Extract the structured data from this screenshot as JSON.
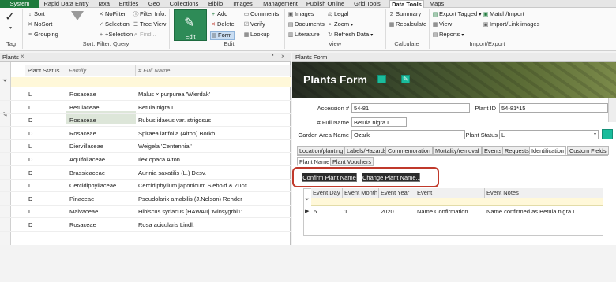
{
  "ribbon_tabs": [
    "System",
    "Rapid Data Entry",
    "Taxa",
    "Entities",
    "Geo",
    "Collections",
    "Biblio",
    "Images",
    "Management",
    "Publish Online",
    "Grid Tools",
    "Data Tools",
    "Maps"
  ],
  "ribbon": {
    "tag_group": {
      "label": "Tag"
    },
    "sort_group": {
      "label": "Sort, Filter, Query",
      "sort": "Sort",
      "nosort": "NoSort",
      "grouping": "Grouping",
      "nofilter": "NoFilter",
      "selection": "Selection",
      "add_selection": "+Selection",
      "filter_info": "Filter Info.",
      "tree_view": "Tree View",
      "find": "Find..."
    },
    "edit_group": {
      "label": "Edit",
      "edit": "Edit",
      "add": "Add",
      "delete": "Delete",
      "form": "Form",
      "comments": "Comments",
      "verify": "Verify",
      "lookup": "Lookup"
    },
    "view_group": {
      "label": "View",
      "images": "Images",
      "documents": "Documents",
      "literature": "Literature",
      "legal": "Legal",
      "zoom": "Zoom",
      "refresh": "Refresh Data"
    },
    "calc_group": {
      "label": "Calculate",
      "summary": "Summary",
      "recalculate": "Recalculate"
    },
    "io_group": {
      "label": "Import/Export",
      "export_tagged": "Export Tagged",
      "view": "View",
      "reports": "Reports",
      "match_import": "Match/Import",
      "import_link": "Import/Link images"
    }
  },
  "plants_grid": {
    "title": "Plants",
    "columns": [
      "Plant Status",
      "Family",
      "# Full Name"
    ],
    "rows": [
      {
        "status": "L",
        "family": "Rosaceae",
        "name": "Malus × purpurea 'Wierdak'"
      },
      {
        "status": "L",
        "family": "Betulaceae",
        "name": "Betula nigra L."
      },
      {
        "status": "D",
        "family": "Rosaceae",
        "name": "Rubus idaeus var. strigosus"
      },
      {
        "status": "D",
        "family": "Rosaceae",
        "name": "Spiraea latifolia (Aiton) Borkh."
      },
      {
        "status": "L",
        "family": "Diervillaceae",
        "name": "Weigela 'Centennial'"
      },
      {
        "status": "D",
        "family": "Aquifoliaceae",
        "name": "Ilex opaca Aiton"
      },
      {
        "status": "D",
        "family": "Brassicaceae",
        "name": "Aurinia saxatilis (L.) Desv."
      },
      {
        "status": "L",
        "family": "Cercidiphyllaceae",
        "name": "Cercidiphyllum japonicum Siebold & Zucc."
      },
      {
        "status": "D",
        "family": "Pinaceae",
        "name": "Pseudolarix amabilis (J.Nelson) Rehder"
      },
      {
        "status": "L",
        "family": "Malvaceae",
        "name": "Hibiscus syriacus [HAWAII] 'Minsygrbl1'"
      },
      {
        "status": "D",
        "family": "Rosaceae",
        "name": "Rosa acicularis Lindl."
      }
    ]
  },
  "form": {
    "window_title": "Plants Form",
    "banner_title": "Plants Form",
    "accession_label": "Accession #",
    "accession_value": "54-81",
    "plant_id_label": "Plant ID",
    "plant_id_value": "54-81*15",
    "full_name_label": "# Full Name",
    "full_name_value": "Betula nigra L.",
    "garden_area_label": "Garden Area Name",
    "garden_area_value": "Ozark",
    "plant_status_label": "Plant Status",
    "plant_status_value": "L",
    "tabs": [
      "Location/planting",
      "Labels/Hazards",
      "Commemoration",
      "Mortality/removal",
      "Events",
      "Requests",
      "Identification",
      "Custom Fields"
    ],
    "subtabs": [
      "Plant Name",
      "Plant Vouchers"
    ],
    "confirm_button": "Confirm Plant Name",
    "change_button": "Change Plant Name...",
    "events_grid": {
      "columns": [
        "Event Day",
        "Event Month",
        "Event Year",
        "Event",
        "Event Notes"
      ],
      "rows": [
        {
          "day": "5",
          "month": "1",
          "year": "2020",
          "event": "Name Confirmation",
          "notes": "Name confirmed as Betula nigra L."
        }
      ]
    }
  },
  "colors": {
    "accent_green": "#1e7a3c",
    "highlight_red": "#c0392b",
    "teal": "#1abc9c"
  }
}
